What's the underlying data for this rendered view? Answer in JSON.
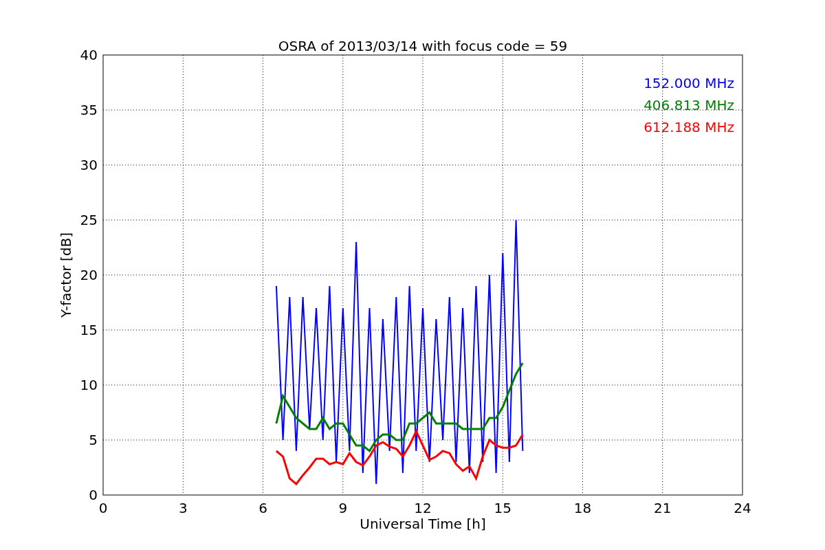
{
  "figure": {
    "chart_data": {
      "type": "line",
      "title": "OSRA of 2013/03/14 with focus code = 59",
      "xlabel": "Universal Time [h]",
      "ylabel": "Y-factor [dB]",
      "x": [
        6.5,
        6.75,
        7,
        7.25,
        7.5,
        7.75,
        8,
        8.25,
        8.5,
        8.75,
        9,
        9.25,
        9.5,
        9.75,
        10,
        10.25,
        10.5,
        10.75,
        11,
        11.25,
        11.5,
        11.75,
        12,
        12.25,
        12.5,
        12.75,
        13,
        13.25,
        13.5,
        13.75,
        14,
        14.25,
        14.5,
        14.75,
        15,
        15.25,
        15.5,
        15.75
      ],
      "series": [
        {
          "name": "152.000 MHz",
          "color": "#0000ff",
          "values": [
            19,
            5,
            18,
            4,
            18,
            6,
            17,
            5,
            19,
            3,
            17,
            4,
            23,
            2,
            17,
            1,
            16,
            4,
            18,
            2,
            19,
            4,
            17,
            3,
            16,
            5,
            18,
            3,
            17,
            2,
            19,
            3,
            20,
            2,
            22,
            3,
            25,
            4
          ]
        },
        {
          "name": "406.813 MHz",
          "color": "#008000",
          "values": [
            6.5,
            9,
            8,
            7,
            6.5,
            6,
            6,
            7,
            6,
            6.5,
            6.5,
            5.5,
            4.5,
            4.5,
            4,
            5,
            5.5,
            5.5,
            5,
            5,
            6.5,
            6.5,
            7,
            7.5,
            6.5,
            6.5,
            6.5,
            6.5,
            6,
            6,
            6,
            6,
            7,
            7,
            8,
            9.5,
            11,
            12
          ]
        },
        {
          "name": "612.188 MHz",
          "color": "#ff0000",
          "values": [
            4,
            3.5,
            1.5,
            1,
            1.8,
            2.5,
            3.3,
            3.3,
            2.8,
            3,
            2.8,
            3.8,
            3,
            2.7,
            3.5,
            4.5,
            4.8,
            4.4,
            4.2,
            3.5,
            4.5,
            5.8,
            4.5,
            3.2,
            3.5,
            4,
            3.8,
            2.8,
            2.2,
            2.6,
            1.5,
            3.5,
            5,
            4.5,
            4.3,
            4.3,
            4.5,
            5.5
          ]
        }
      ],
      "grid": true,
      "xlim": [
        0,
        24
      ],
      "ylim": [
        0,
        40
      ],
      "xticks": [
        0,
        3,
        6,
        9,
        12,
        15,
        18,
        21,
        24
      ],
      "yticks": [
        0,
        5,
        10,
        15,
        20,
        25,
        30,
        35,
        40
      ]
    }
  }
}
